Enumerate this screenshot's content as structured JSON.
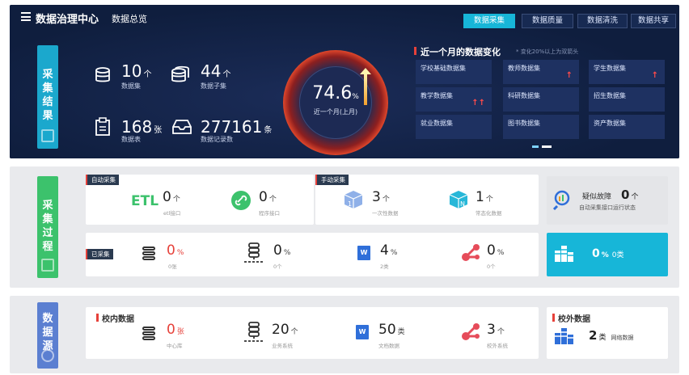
{
  "header": {
    "title": "数据治理中心",
    "subtitle": "数据总览",
    "tabs": [
      "数据采集",
      "数据质量",
      "数据清洗",
      "数据共享"
    ],
    "active_tab": 0
  },
  "collection_result": {
    "sidebar_label": "采集结果",
    "stats": [
      {
        "value": "10",
        "unit": "个",
        "label": "数据集",
        "icon": "database-icon"
      },
      {
        "value": "44",
        "unit": "个",
        "label": "数据子集",
        "icon": "database-stack-icon"
      },
      {
        "value": "168",
        "unit": "张",
        "label": "数据表",
        "icon": "clipboard-icon"
      },
      {
        "value": "277161",
        "unit": "条",
        "label": "数据记录数",
        "icon": "inbox-icon"
      }
    ],
    "gauge": {
      "value": "74.6",
      "unit": "%",
      "label": "近一个月(上月)",
      "fraction": 0.746
    }
  },
  "recent_changes": {
    "title": "近一个月的数据变化",
    "note": "* 变化20%以上为双箭头",
    "datasets": [
      {
        "name": "学校基础数据集",
        "arrows": ""
      },
      {
        "name": "教师数据集",
        "arrows": "↑"
      },
      {
        "name": "学生数据集",
        "arrows": "↑"
      },
      {
        "name": "教学数据集",
        "arrows": "↑↑"
      },
      {
        "name": "科研数据集",
        "arrows": ""
      },
      {
        "name": "招生数据集",
        "arrows": ""
      },
      {
        "name": "就业数据集",
        "arrows": ""
      },
      {
        "name": "图书数据集",
        "arrows": ""
      },
      {
        "name": "资产数据集",
        "arrows": ""
      }
    ]
  },
  "collection_process": {
    "sidebar_label": "采集过程",
    "auto_tag": "自动采集",
    "manual_tag": "手动采集",
    "collected_tag": "已采集",
    "auto": [
      {
        "icon_text": "ETL",
        "value": "0",
        "unit": "个",
        "label": "etl接口"
      },
      {
        "value": "0",
        "unit": "个",
        "label": "程序接口"
      }
    ],
    "manual": [
      {
        "value": "3",
        "unit": "个",
        "label": "一次性数据"
      },
      {
        "value": "1",
        "unit": "个",
        "label": "常态化数据"
      }
    ],
    "fault": {
      "label": "疑似故障",
      "value": "0",
      "unit": "个",
      "sub": "自动采集接口运行状态"
    },
    "collected": [
      {
        "value": "0",
        "unit": "%",
        "label": "0张",
        "red": true
      },
      {
        "value": "0",
        "unit": "%",
        "label": "0个",
        "red": false
      },
      {
        "value": "4",
        "unit": "%",
        "label": "2类",
        "red": false
      },
      {
        "value": "0",
        "unit": "%",
        "label": "0个",
        "red": false
      }
    ],
    "network": {
      "value": "0",
      "unit": "%",
      "label": "0类"
    }
  },
  "data_source": {
    "sidebar_label": "数据源",
    "inner_title": "校内数据",
    "outer_title": "校外数据",
    "inner": [
      {
        "value": "0",
        "unit": "张",
        "label": "中心库",
        "red": true
      },
      {
        "value": "20",
        "unit": "个",
        "label": "业务系统",
        "red": false
      },
      {
        "value": "50",
        "unit": "类",
        "label": "文档数据",
        "red": false
      },
      {
        "value": "3",
        "unit": "个",
        "label": "校外系统",
        "red": false
      }
    ],
    "outer": {
      "value": "2",
      "unit": "类",
      "label": "网络数据"
    }
  },
  "colors": {
    "accent": "#17b6d8",
    "dark_bg": "#0f1e3e",
    "green": "#3cc26c",
    "blue": "#5b7fd1",
    "red": "#e6413a"
  }
}
